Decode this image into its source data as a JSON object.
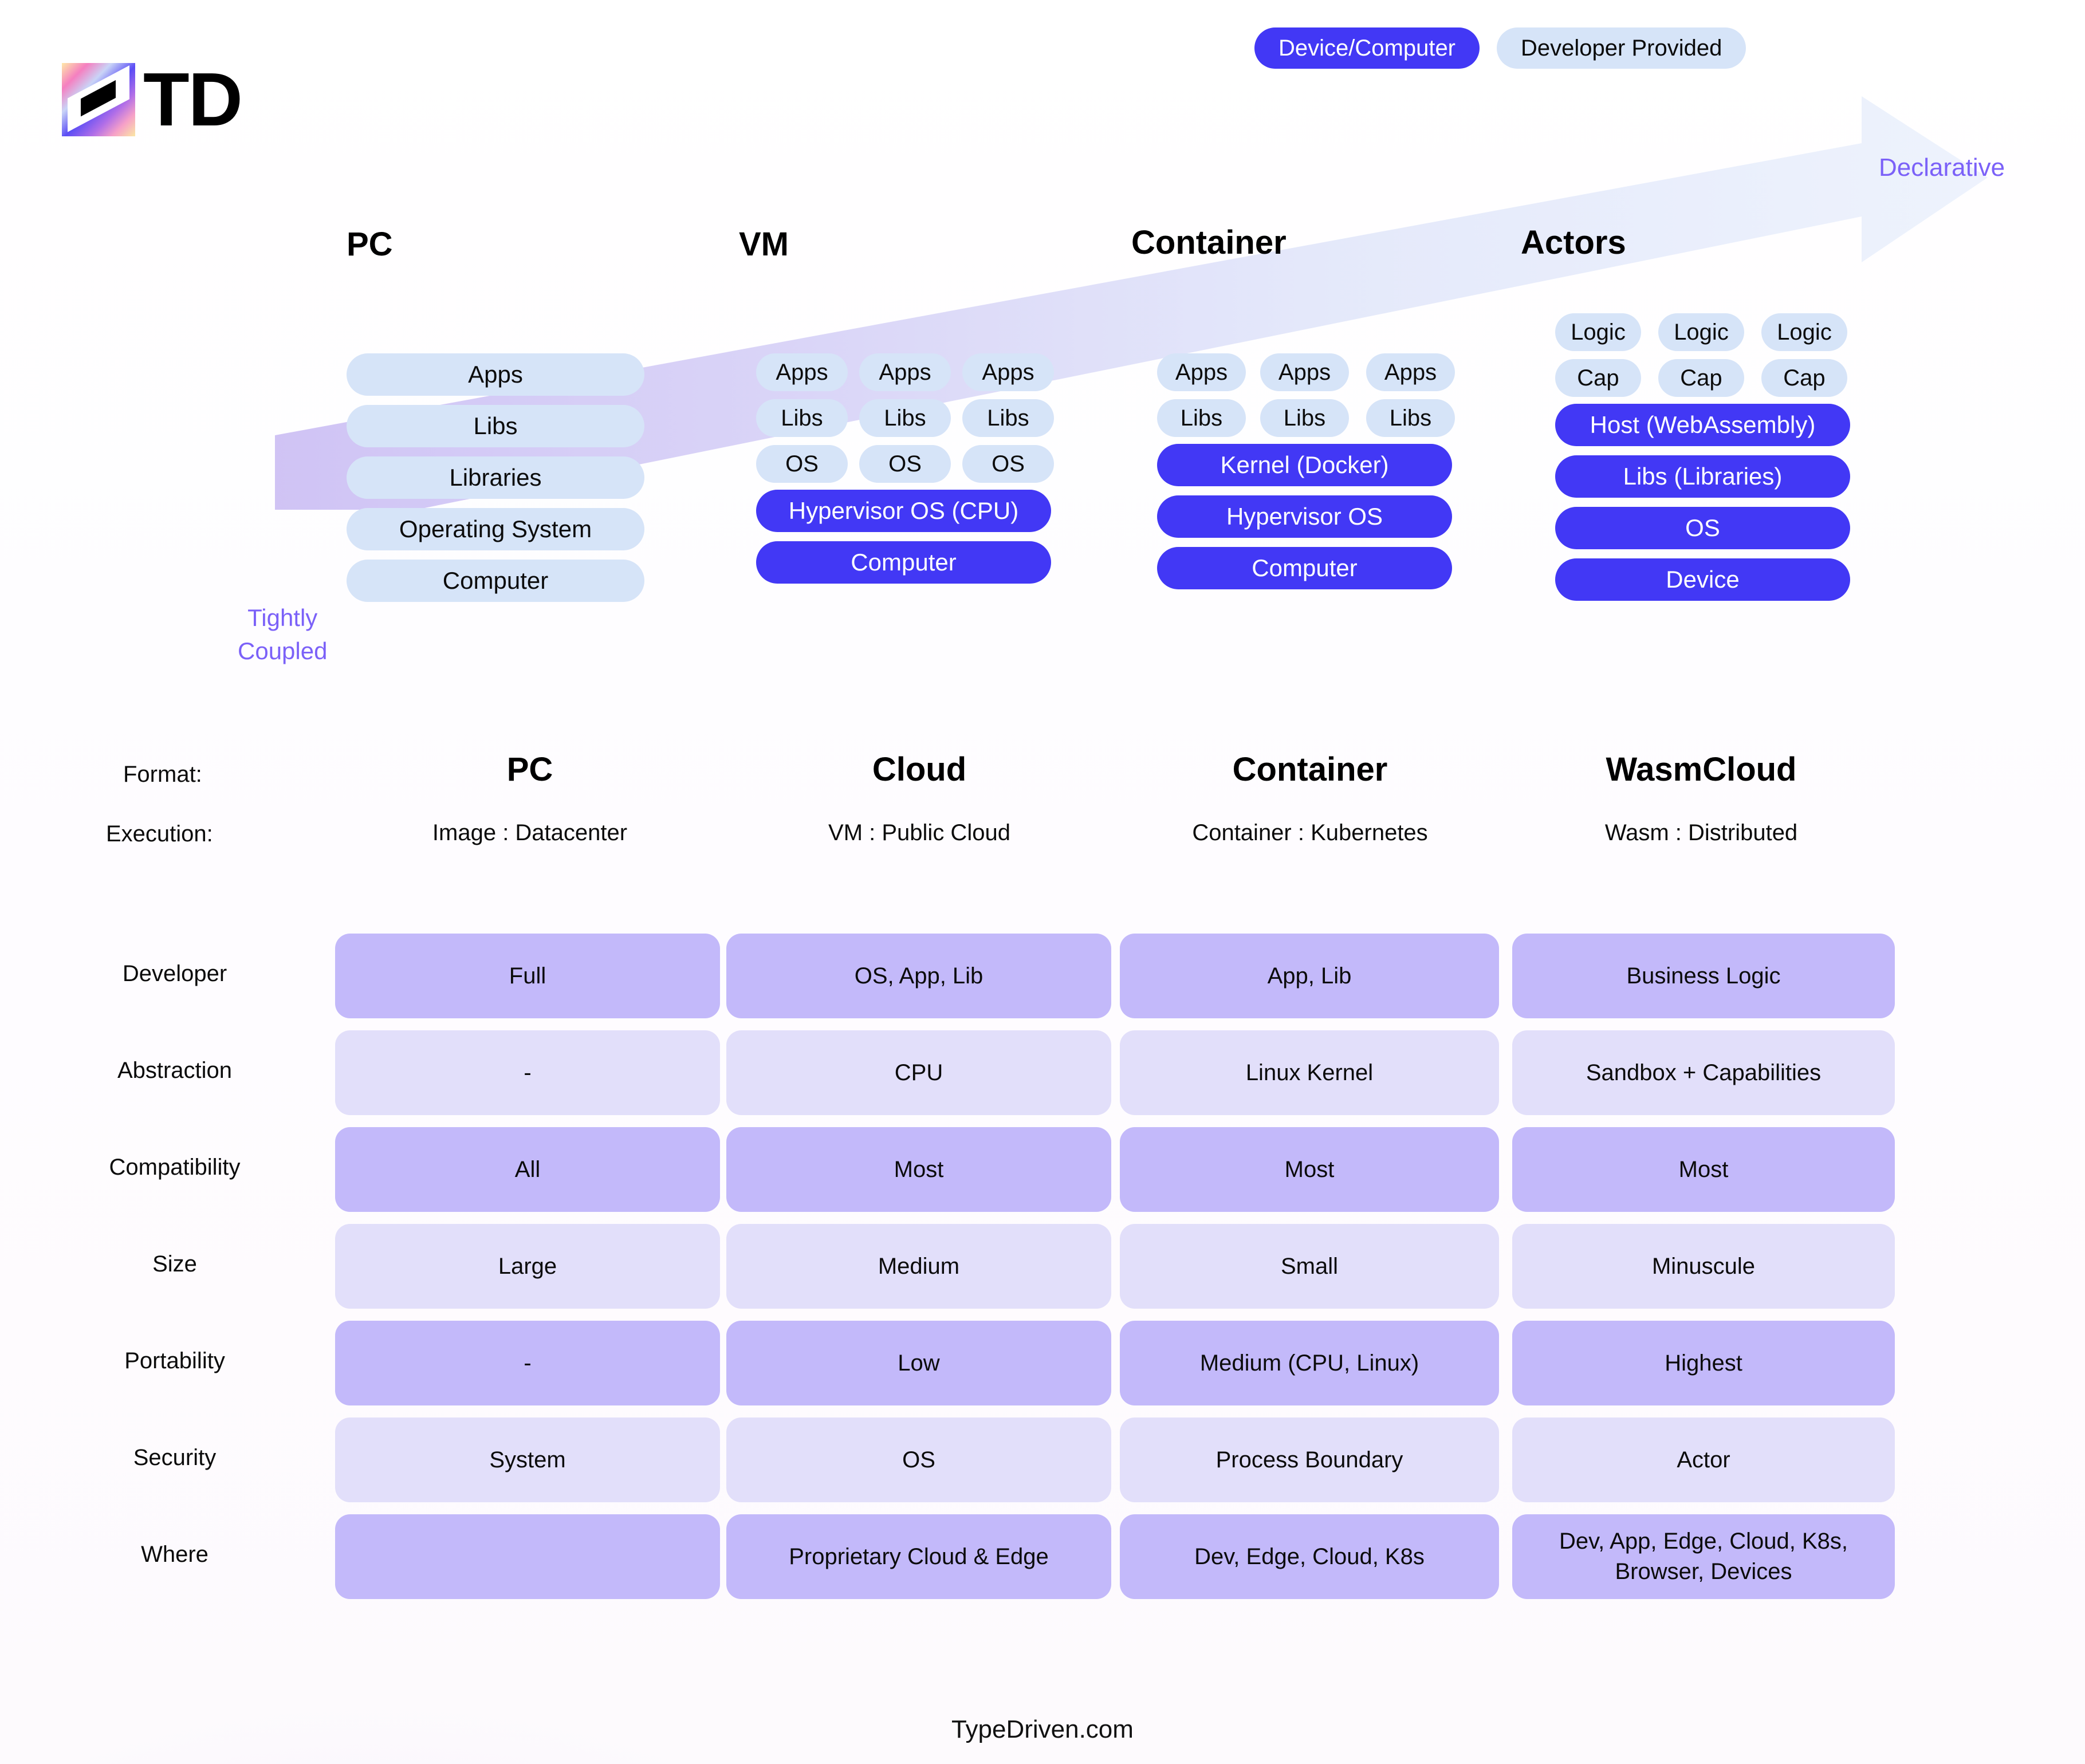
{
  "brand": {
    "logo_text": "TD",
    "footer": "TypeDriven.com"
  },
  "legend": [
    {
      "label": "Device/Computer",
      "style": "dark",
      "color": "#4238f5"
    },
    {
      "label": "Developer Provided",
      "style": "light",
      "color": "#d6e4f8"
    }
  ],
  "axis": {
    "left_label": "Tightly\nCoupled",
    "left_line1": "Tightly",
    "left_line2": "Coupled",
    "right_label": "Declarative"
  },
  "stacks": [
    {
      "title": "PC",
      "layers": [
        {
          "label": "Apps",
          "tone": "light"
        },
        {
          "label": "Libs",
          "tone": "light"
        },
        {
          "label": "Libraries",
          "tone": "light"
        },
        {
          "label": "Operating System",
          "tone": "light"
        },
        {
          "label": "Computer",
          "tone": "light"
        }
      ]
    },
    {
      "title": "VM",
      "columns": [
        [
          "Apps",
          "Libs",
          "OS"
        ],
        [
          "Apps",
          "Libs",
          "OS"
        ],
        [
          "Apps",
          "Libs",
          "OS"
        ]
      ],
      "base": [
        {
          "label": "Hypervisor OS (CPU)",
          "tone": "dark"
        },
        {
          "label": "Computer",
          "tone": "dark"
        }
      ]
    },
    {
      "title": "Container",
      "columns": [
        [
          "Apps",
          "Libs"
        ],
        [
          "Apps",
          "Libs"
        ],
        [
          "Apps",
          "Libs"
        ]
      ],
      "base": [
        {
          "label": "Kernel (Docker)",
          "tone": "dark"
        },
        {
          "label": "Hypervisor OS",
          "tone": "dark"
        },
        {
          "label": "Computer",
          "tone": "dark"
        }
      ]
    },
    {
      "title": "Actors",
      "columns": [
        [
          "Logic",
          "Cap"
        ],
        [
          "Logic",
          "Cap"
        ],
        [
          "Logic",
          "Cap"
        ]
      ],
      "base": [
        {
          "label": "Host (WebAssembly)",
          "tone": "dark"
        },
        {
          "label": "Libs (Libraries)",
          "tone": "dark"
        },
        {
          "label": "OS",
          "tone": "dark"
        },
        {
          "label": "Device",
          "tone": "dark"
        }
      ]
    }
  ],
  "meta": {
    "format_label": "Format:",
    "execution_label": "Execution:",
    "formats": [
      "PC",
      "Cloud",
      "Container",
      "WasmCloud"
    ],
    "executions": [
      "Image : Datacenter",
      "VM : Public Cloud",
      "Container : Kubernetes",
      "Wasm : Distributed"
    ]
  },
  "table": {
    "rows": [
      {
        "label": "Developer",
        "tone": "dark",
        "cells": [
          "Full",
          "OS, App, Lib",
          "App, Lib",
          "Business Logic"
        ]
      },
      {
        "label": "Abstraction",
        "tone": "light",
        "cells": [
          "-",
          "CPU",
          "Linux Kernel",
          "Sandbox + Capabilities"
        ]
      },
      {
        "label": "Compatibility",
        "tone": "dark",
        "cells": [
          "All",
          "Most",
          "Most",
          "Most"
        ]
      },
      {
        "label": "Size",
        "tone": "light",
        "cells": [
          "Large",
          "Medium",
          "Small",
          "Minuscule"
        ]
      },
      {
        "label": "Portability",
        "tone": "dark",
        "cells": [
          "-",
          "Low",
          "Medium (CPU, Linux)",
          "Highest"
        ]
      },
      {
        "label": "Security",
        "tone": "light",
        "cells": [
          "System",
          "OS",
          "Process Boundary",
          "Actor"
        ]
      },
      {
        "label": "Where",
        "tone": "dark",
        "cells": [
          "",
          "Proprietary Cloud & Edge",
          "Dev, Edge, Cloud, K8s",
          "Dev, App, Edge, Cloud, K8s,\nBrowser, Devices"
        ]
      }
    ]
  },
  "colors": {
    "dark_blue": "#4238f5",
    "light_blue": "#d6e4f8",
    "cell_dark": "#c3b9fa",
    "cell_light": "#e2dffa",
    "accent_purple": "#7b61f8"
  }
}
